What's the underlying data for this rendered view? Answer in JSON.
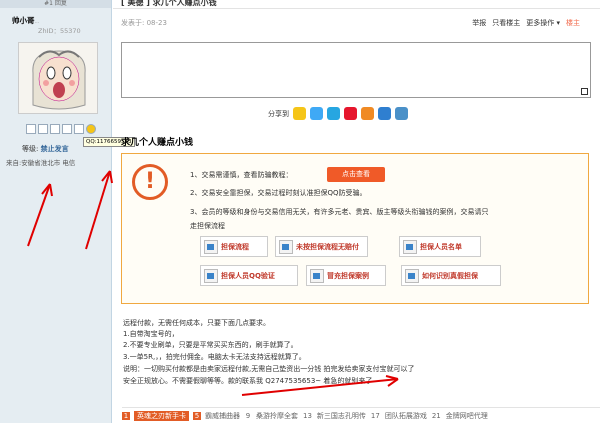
{
  "sidebar": {
    "top_text": "#1 回复",
    "username": "帅小哥",
    "username_suffix": "...",
    "uid": "ZhID：55370",
    "qq_tooltip": "QQ:1176659583",
    "level_label": "等级:",
    "level_value": "禁止发言",
    "from": "来自:安徽省淮北市 电信"
  },
  "post": {
    "title": "[ 美德 ] 求几个人赚点小钱",
    "posted": "发表于: 08-23",
    "actions": [
      "举报",
      "只看楼主",
      "更多操作 ▾"
    ],
    "host_badge": "楼主",
    "share_label": "分享到",
    "share_icons": [
      "qq-icon",
      "qzone-icon",
      "weibo-icon",
      "tencent-weibo-icon",
      "renren-icon",
      "star-icon",
      "douban-icon"
    ],
    "heading": "求几个人赚点小钱"
  },
  "notice": {
    "line1": "1、交易需谨慎，查看防骗教程：",
    "btn_check": "点击查看",
    "line2": "2、交易安全靠担保，交易过程时刻认准担保QQ防受骗。",
    "line3": "3、会员的等级和身份与交易信用无关，有许多元老、贵宾、版主等级头衔骗钱的案例，交易请只",
    "line3b": "走担保流程",
    "buttons": [
      "担保流程",
      "未按担保流程无赔付",
      "担保人员名单",
      "担保人员QQ验证",
      "冒充担保案例",
      "如何识别真假担保"
    ]
  },
  "body": [
    "远程付款，无需任何成本，只要下面几点要求。",
    "1.自带淘宝号的，",
    "2.不要专业刷单，只要是平常买买东西的，刷手就算了。",
    "3.一单5R,，，拍完付佣金。电脑太卡无法支持远程就算了。",
    "说明：一切购买付款都是由卖家远程付款,无需自己垫资出一分钱 拍完发给卖家支付宝就可以了",
    "安全正规放心。不需要假聊等等。款的联系我 Q2747535653~ 着急的就别来了"
  ],
  "bottom_links": [
    {
      "rank": "1",
      "text": "英魂之刃新手卡"
    },
    {
      "rank": "5",
      "text": "霸威捕曲器"
    },
    {
      "rank": "9",
      "text": "桑游拎摩全套"
    },
    {
      "rank": "13",
      "text": "新三国志孔明传"
    },
    {
      "rank": "17",
      "text": "团队拓展游戏"
    },
    {
      "rank": "21",
      "text": "金牌网吧代理"
    }
  ],
  "colors": {
    "accent": "#e25c26",
    "link": "#336699",
    "arrow": "#e00000"
  }
}
